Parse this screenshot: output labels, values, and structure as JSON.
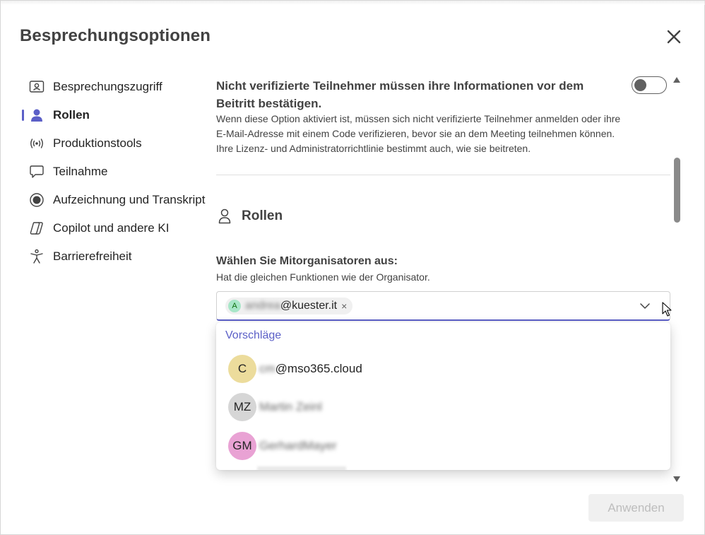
{
  "dialog": {
    "title": "Besprechungsoptionen",
    "close_icon": "close-icon"
  },
  "nav": {
    "items": [
      {
        "label": "Besprechungszugriff",
        "icon": "person-card-icon",
        "active": false
      },
      {
        "label": "Rollen",
        "icon": "person-icon",
        "active": true
      },
      {
        "label": "Produktionstools",
        "icon": "broadcast-icon",
        "active": false
      },
      {
        "label": "Teilnahme",
        "icon": "chat-bubble-icon",
        "active": false
      },
      {
        "label": "Aufzeichnung und Transkript",
        "icon": "record-icon",
        "active": false
      },
      {
        "label": "Copilot und andere KI",
        "icon": "copilot-icon",
        "active": false
      },
      {
        "label": "Barrierefreiheit",
        "icon": "accessibility-icon",
        "active": false
      }
    ]
  },
  "option": {
    "title": "Nicht verifizierte Teilnehmer müssen ihre Informationen vor dem Beitritt bestätigen.",
    "description": "Wenn diese Option aktiviert ist, müssen sich nicht verifizierte Teilnehmer anmelden oder ihre E-Mail-Adresse mit einem Code verifizieren, bevor sie an dem Meeting teilnehmen können. Ihre Lizenz- und Administratorrichtlinie bestimmt auch, wie sie beitreten.",
    "toggle_on": false
  },
  "section": {
    "title": "Rollen",
    "icon": "person-outline-icon"
  },
  "coorganizers": {
    "label": "Wählen Sie Mitorganisatoren aus:",
    "help": "Hat die gleichen Funktionen wie der Organisator.",
    "chip": {
      "initial": "A",
      "blurred": "andrea",
      "domain": "@kuester.it",
      "remove": "×"
    }
  },
  "suggestions": {
    "header": "Vorschläge",
    "items": [
      {
        "initials": "C",
        "blurred": "cm",
        "visible": "@mso365.cloud",
        "color": "#ecdc9c"
      },
      {
        "initials": "MZ",
        "blurred": "Martin Zeinl",
        "visible": "",
        "color": "#d6d6d6"
      },
      {
        "initials": "GM",
        "blurred": "GerhardMayer",
        "visible": "",
        "color": "#e9a2d4"
      }
    ]
  },
  "footer": {
    "apply_label": "Anwenden"
  },
  "colors": {
    "accent": "#5b5fc7",
    "text": "#424242",
    "disabled_text": "#bdbdbd"
  }
}
